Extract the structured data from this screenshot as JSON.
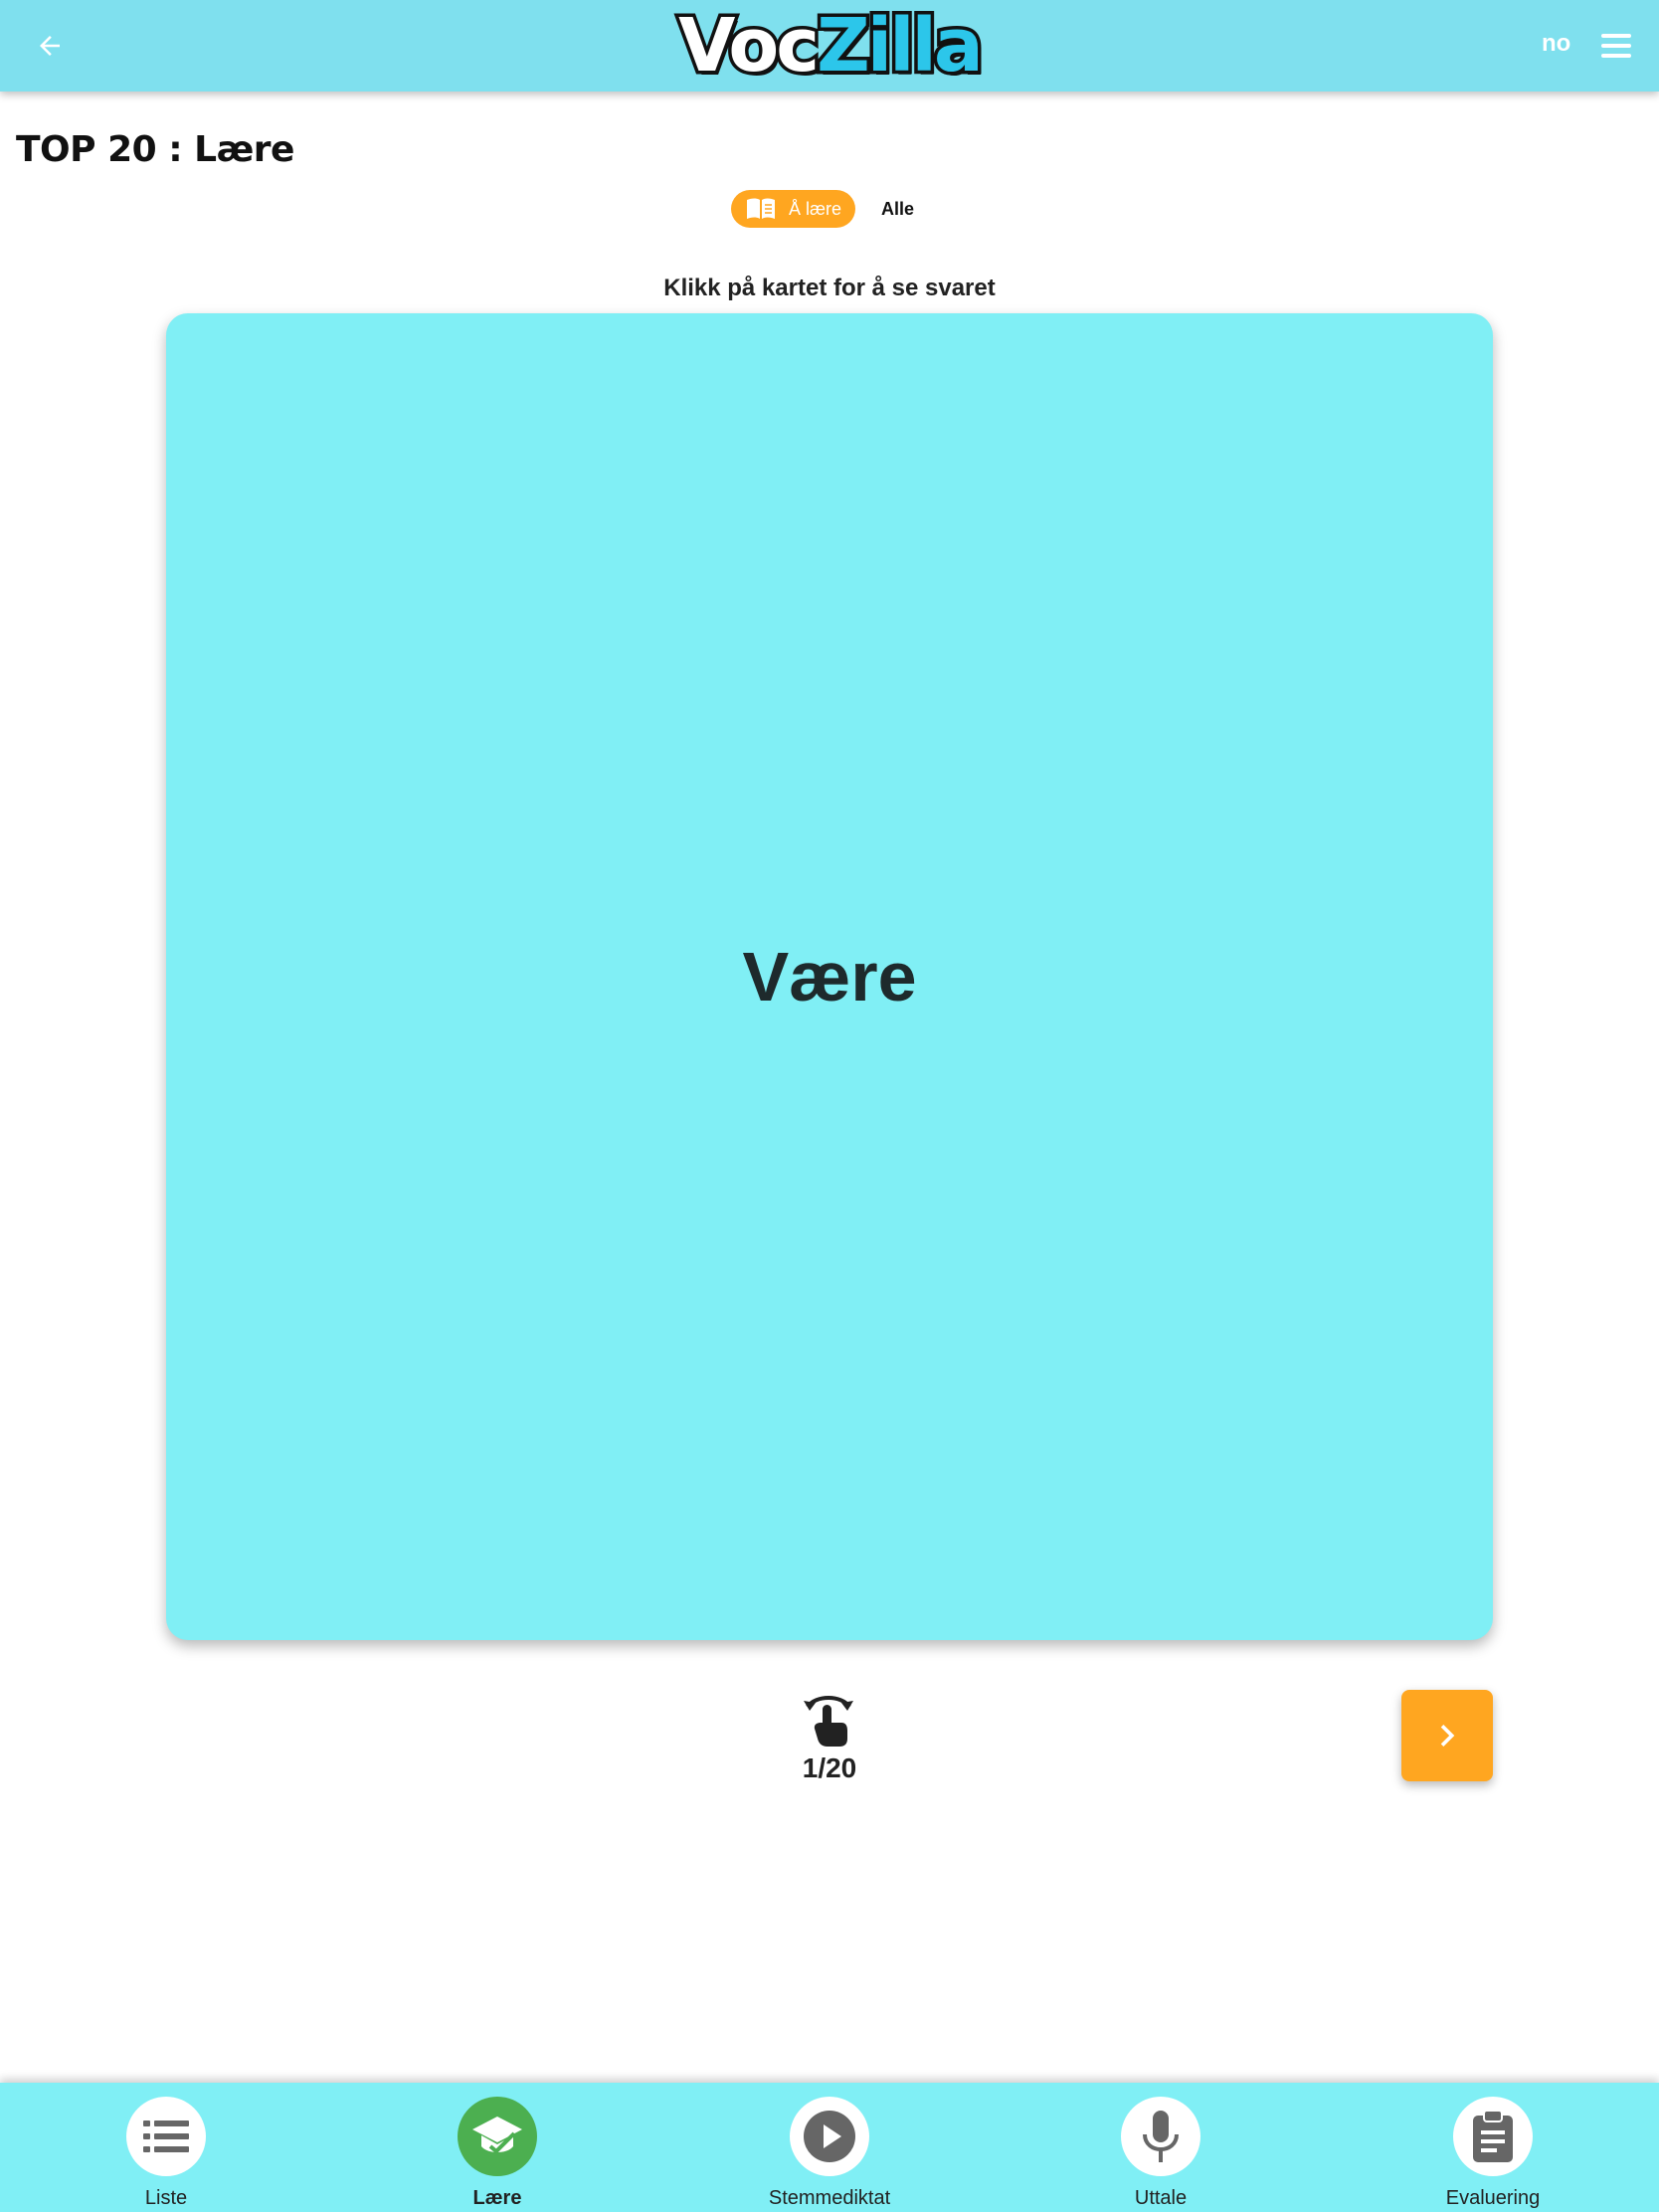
{
  "header": {
    "logo_part1": "Voc",
    "logo_part2": "Zilla",
    "language": "no"
  },
  "page": {
    "title": "TOP 20 : Lære",
    "filters": {
      "active_label": "Å lære",
      "all_label": "Alle"
    },
    "instruction": "Klikk på kartet for å se svaret"
  },
  "card": {
    "word": "Være",
    "counter": "1/20"
  },
  "bottom_nav": {
    "items": [
      {
        "label": "Liste",
        "icon": "list-icon",
        "active": false
      },
      {
        "label": "Lære",
        "icon": "graduation-cap-icon",
        "active": true
      },
      {
        "label": "Stemmediktat",
        "icon": "play-icon",
        "active": false
      },
      {
        "label": "Uttale",
        "icon": "microphone-icon",
        "active": false
      },
      {
        "label": "Evaluering",
        "icon": "clipboard-icon",
        "active": false
      }
    ]
  },
  "colors": {
    "header_bg": "#7fe0ee",
    "card_bg": "#80eff5",
    "accent_orange": "#ffa620",
    "active_green": "#4caf50"
  }
}
